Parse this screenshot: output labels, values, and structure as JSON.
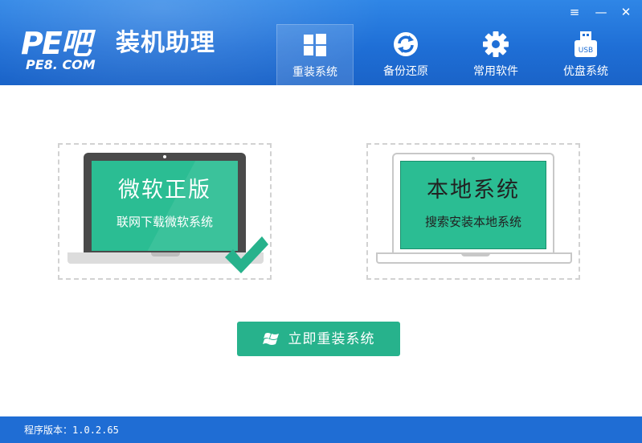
{
  "header": {
    "logo_mark": "PE吧",
    "logo_sub": "PE8. COM",
    "app_name": "装机助理",
    "window_controls": {
      "menu": "≡",
      "minimize": "—",
      "close": "✕"
    }
  },
  "tabs": [
    {
      "label": "重装系统",
      "icon": "windows-icon",
      "active": true
    },
    {
      "label": "备份还原",
      "icon": "sync-icon",
      "active": false
    },
    {
      "label": "常用软件",
      "icon": "gear-icon",
      "active": false
    },
    {
      "label": "优盘系统",
      "icon": "usb-icon",
      "active": false
    }
  ],
  "options": {
    "online": {
      "title": "微软正版",
      "subtitle": "联网下载微软系统",
      "selected": true
    },
    "local": {
      "title": "本地系统",
      "subtitle": "搜索安装本地系统",
      "selected": false
    }
  },
  "start_button": {
    "label": "立即重装系统",
    "icon": "windows-flag-icon"
  },
  "footer": {
    "version_label": "程序版本：",
    "version": "1.0.2.65"
  },
  "colors": {
    "header_blue": "#1f6fd6",
    "accent_green": "#27b28c",
    "screen_green": "#2bbd93",
    "footer_blue": "#1f6dd4"
  }
}
